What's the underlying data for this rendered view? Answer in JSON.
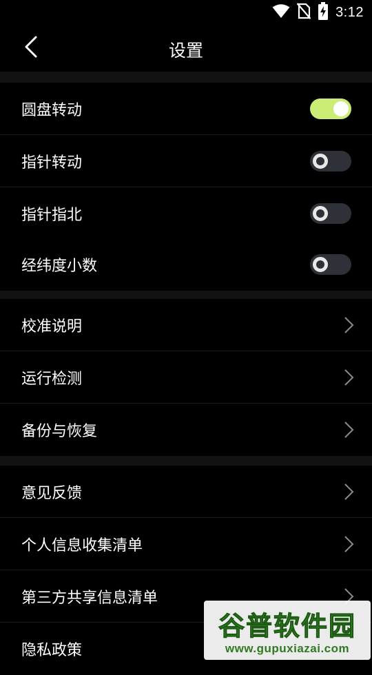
{
  "status_bar": {
    "time": "3:12",
    "icons": [
      "wifi-icon",
      "no-sim-icon",
      "battery-charging-icon"
    ]
  },
  "app_bar": {
    "title": "设置",
    "back_icon": "chevron-left-icon"
  },
  "colors": {
    "background": "#000000",
    "section_gap": "#121212",
    "toggle_on": "#cbed75",
    "toggle_off": "#2e3137",
    "text": "#ffffff"
  },
  "sections": [
    {
      "items": [
        {
          "label": "圆盘转动",
          "type": "toggle",
          "checked": true
        },
        {
          "label": "指针转动",
          "type": "toggle",
          "checked": false
        },
        {
          "label": "指针指北",
          "type": "toggle",
          "checked": false
        },
        {
          "label": "经纬度小数",
          "type": "toggle",
          "checked": false
        }
      ]
    },
    {
      "items": [
        {
          "label": "校准说明",
          "type": "link"
        },
        {
          "label": "运行检测",
          "type": "link"
        },
        {
          "label": "备份与恢复",
          "type": "link"
        }
      ]
    },
    {
      "items": [
        {
          "label": "意见反馈",
          "type": "link"
        },
        {
          "label": "个人信息收集清单",
          "type": "link"
        },
        {
          "label": "第三方共享信息清单",
          "type": "link"
        },
        {
          "label": "隐私政策",
          "type": "link"
        }
      ]
    }
  ],
  "watermark": {
    "name": "谷普软件园",
    "url": "www.gupuxiazai.com"
  }
}
